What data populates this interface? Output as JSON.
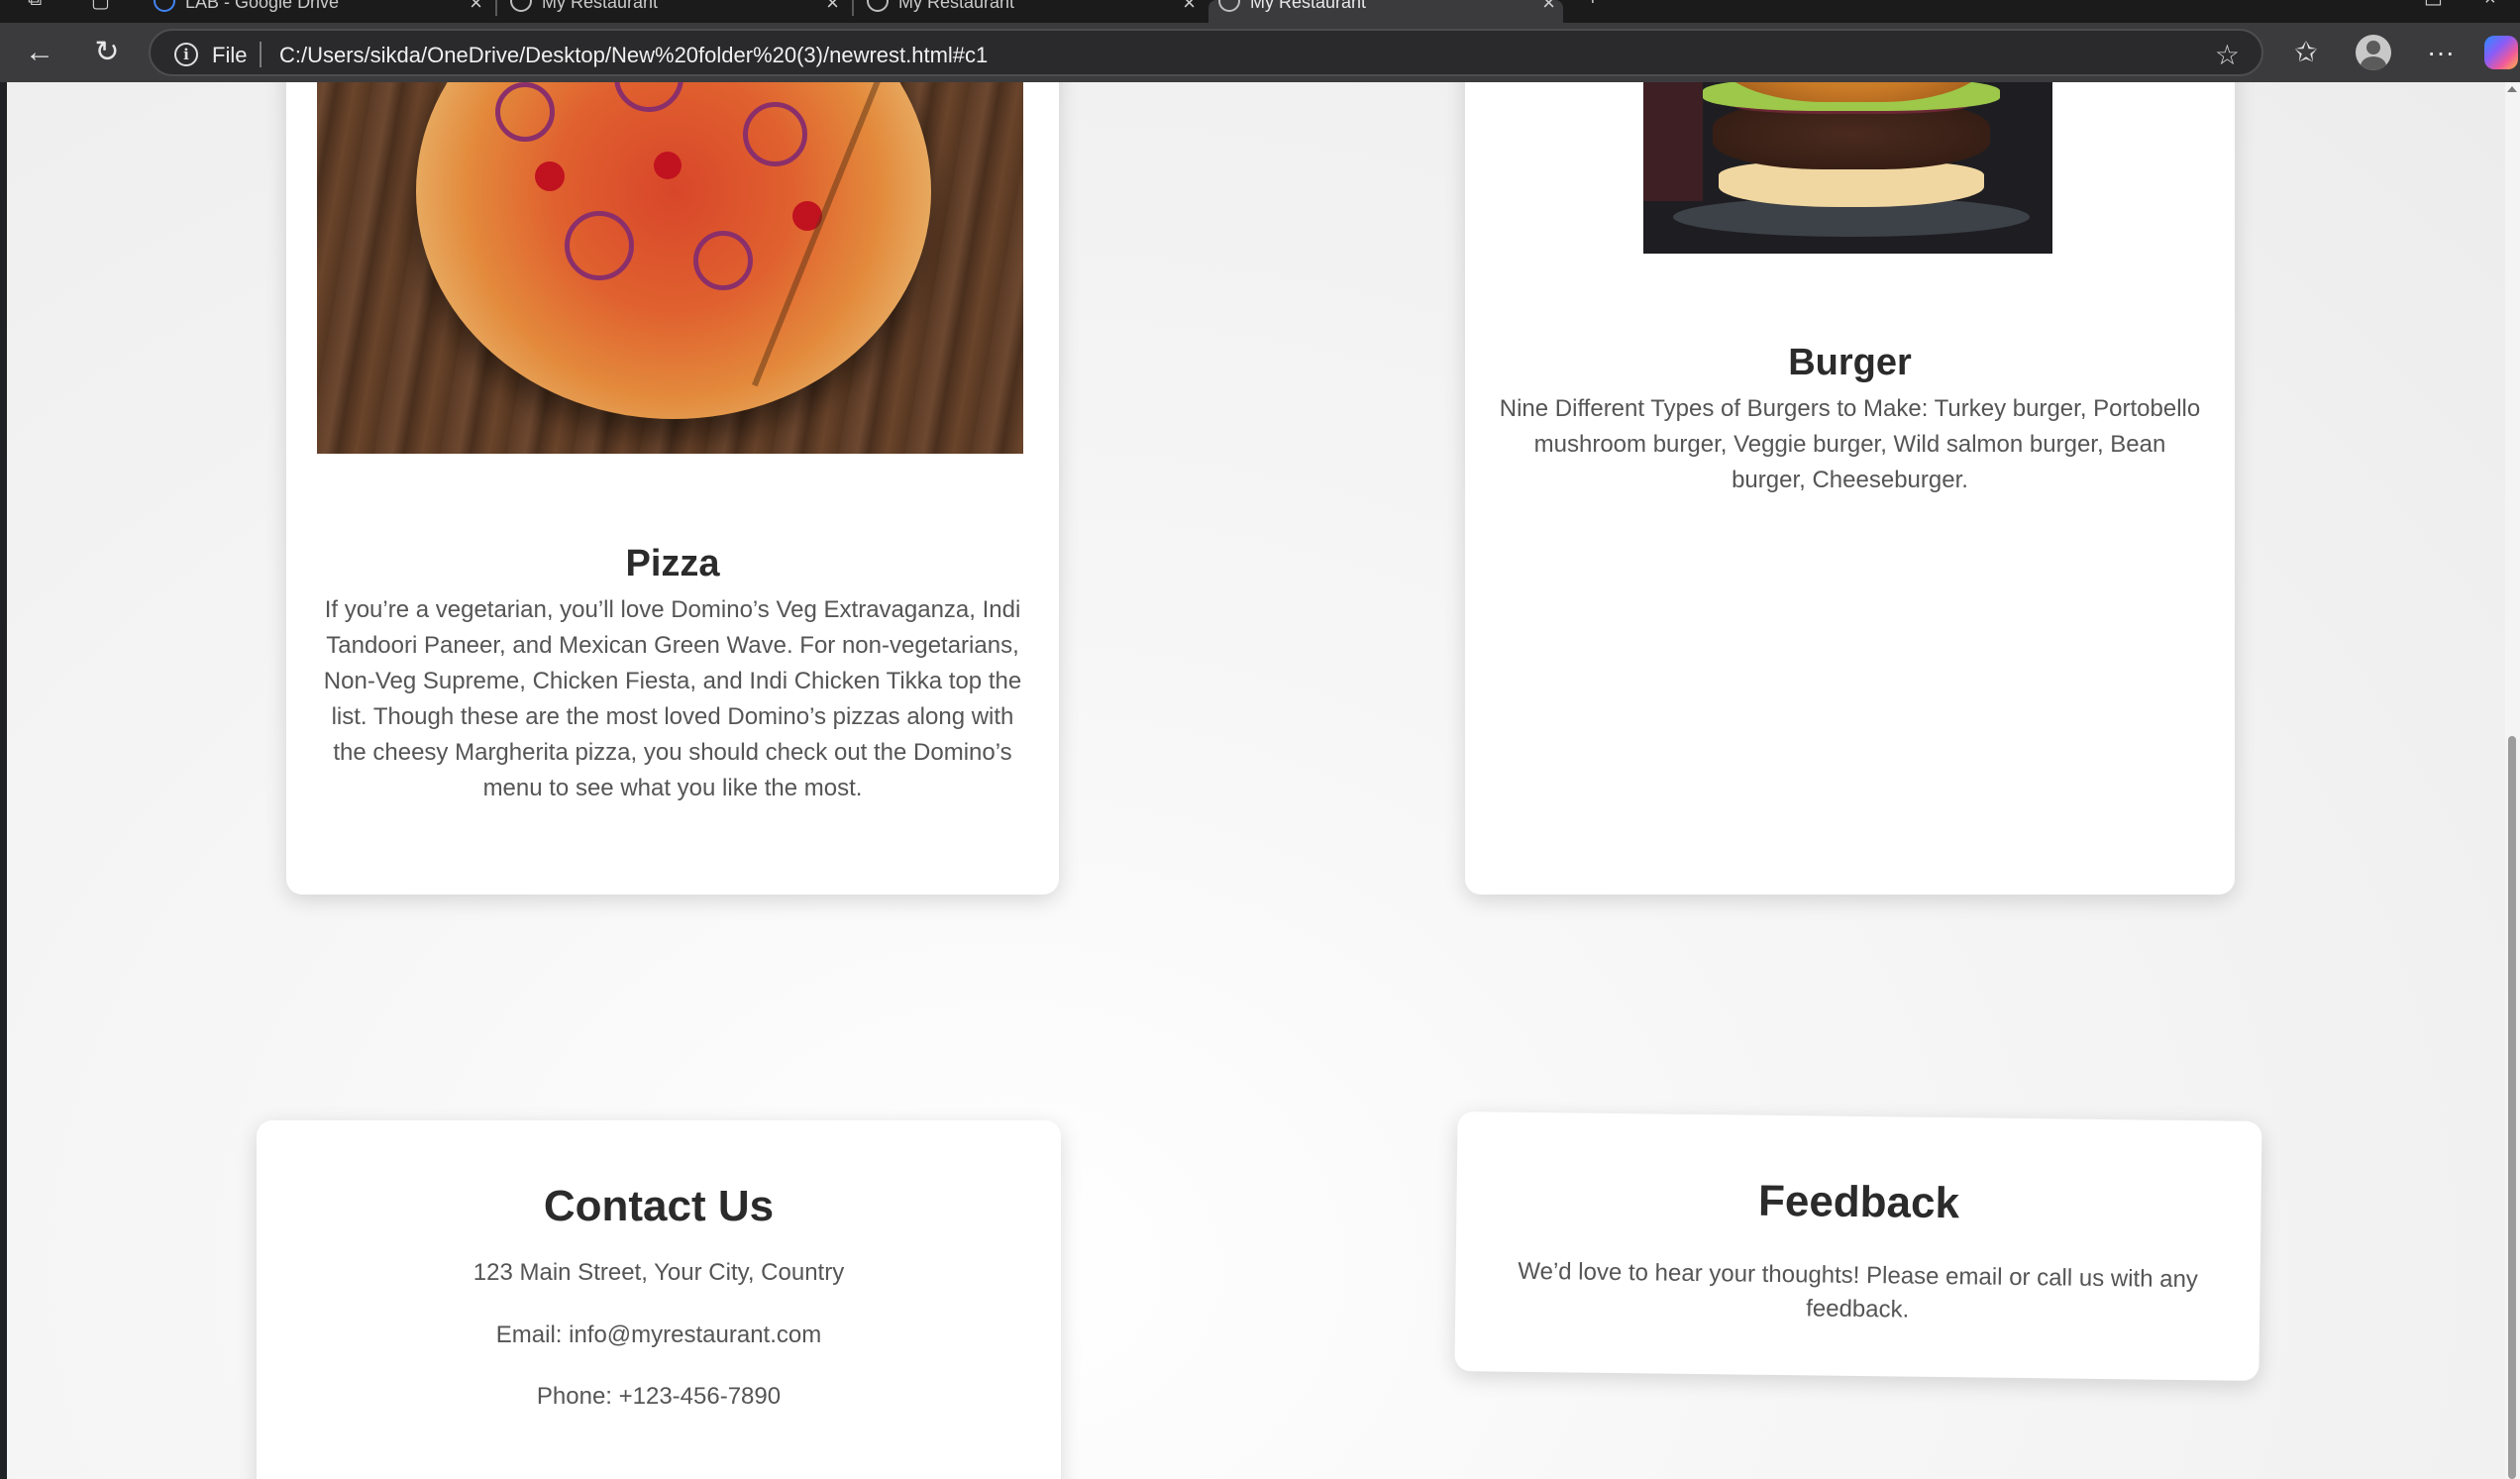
{
  "browser": {
    "tabs": [
      {
        "title": "LAB - Google Drive"
      },
      {
        "title": "My Restaurant"
      },
      {
        "title": "My Restaurant"
      },
      {
        "title": "My Restaurant"
      }
    ],
    "new_tab_label": "+",
    "address": {
      "scheme_label": "File",
      "url": "C:/Users/sikda/OneDrive/Desktop/New%20folder%20(3)/newrest.html#c1"
    },
    "icons": {
      "back": "back-arrow-icon",
      "reload": "reload-icon",
      "info": "info-icon",
      "favorite": "star-icon",
      "favorites_list": "favorites-icon",
      "profile": "profile-icon",
      "menu": "more-icon",
      "copilot": "copilot-icon"
    }
  },
  "menu": {
    "items": [
      {
        "title": "Pizza",
        "description": "If you’re a vegetarian, you’ll love Domino’s Veg Extravaganza, Indi Tandoori Paneer, and Mexican Green Wave. For non-vegetarians, Non-Veg Supreme, Chicken Fiesta, and Indi Chicken Tikka top the list. Though these are the most loved Domino’s pizzas along with the cheesy Margherita pizza, you should check out the Domino’s menu to see what you like the most."
      },
      {
        "title": "Burger",
        "description": "Nine Different Types of Burgers to Make: Turkey burger, Portobello mushroom burger, Veggie burger, Wild salmon burger, Bean burger, Cheeseburger."
      }
    ]
  },
  "contact": {
    "title": "Contact Us",
    "address": "123 Main Street, Your City, Country",
    "email": "Email: info@myrestaurant.com",
    "phone": "Phone: +123-456-7890"
  },
  "feedback": {
    "title": "Feedback",
    "text": "We’d love to hear your thoughts! Please email or call us with any feedback."
  },
  "colors": {
    "page_background": "#f2f2f2",
    "card_background": "#ffffff",
    "heading": "#2b2b2b",
    "body_text": "#555555",
    "browser_frame": "#3b3b3d"
  }
}
